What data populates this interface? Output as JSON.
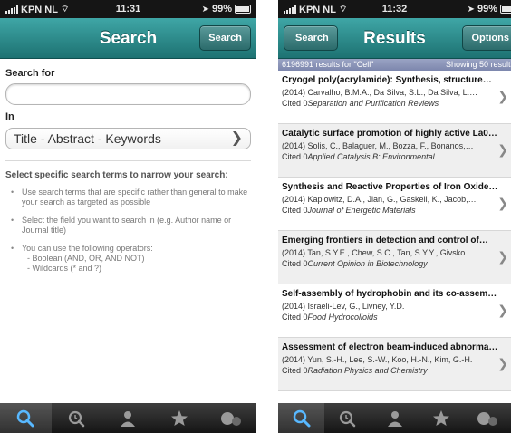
{
  "left": {
    "status": {
      "carrier": "KPN NL",
      "time": "11:31",
      "battery": "99%"
    },
    "nav": {
      "title": "Search",
      "search_button": "Search"
    },
    "form": {
      "search_for_label": "Search for",
      "search_value": "",
      "in_label": "In",
      "in_selected": "Title - Abstract - Keywords"
    },
    "help": {
      "title": "Select specific search terms to narrow your search:",
      "tip1": "Use search terms that are specific rather than general to make your search as targeted as possible",
      "tip2": "Select the field you want to search in (e.g. Author name or Journal title)",
      "tip3": "You can use the following operators:",
      "tip3_sub1": "- Boolean (AND, OR, AND NOT)",
      "tip3_sub2": "- Wildcards (* and ?)"
    },
    "tabs": [
      "search-icon",
      "recent-search-icon",
      "people-icon",
      "star-icon",
      "more-icon"
    ],
    "active_tab": 0
  },
  "right": {
    "status": {
      "carrier": "KPN NL",
      "time": "11:32",
      "battery": "99%"
    },
    "nav": {
      "title": "Results",
      "back_button": "Search",
      "options_button": "Options"
    },
    "results_bar": {
      "count": "6196991 results for \"Cell\"",
      "showing": "Showing 50 results"
    },
    "items": [
      {
        "title": "Cryogel poly(acrylamide): Synthesis, structure…",
        "authors": "(2014) Carvalho, B.M.A., Da Silva, S.L., Da Silva, L.…",
        "cited": "Cited 0",
        "journal": "Separation and Purification Reviews"
      },
      {
        "title": "Catalytic surface promotion of highly active La0…",
        "authors": "(2014) Solis, C., Balaguer, M., Bozza, F., Bonanos,…",
        "cited": "Cited 0",
        "journal": "Applied Catalysis B: Environmental"
      },
      {
        "title": "Synthesis and Reactive Properties of Iron Oxide-…",
        "authors": "(2014) Kaplowitz, D.A., Jian, G., Gaskell, K., Jacob,…",
        "cited": "Cited 0",
        "journal": "Journal of Energetic Materials"
      },
      {
        "title": "Emerging frontiers in detection and control of…",
        "authors": "(2014) Tan, S.Y.E., Chew, S.C., Tan, S.Y.Y., Givsko…",
        "cited": "Cited 0",
        "journal": "Current Opinion in Biotechnology"
      },
      {
        "title": "Self-assembly of hydrophobin and its co-assem…",
        "authors": "(2014) Israeli-Lev, G., Livney, Y.D.",
        "cited": "Cited 0",
        "journal": "Food Hydrocolloids"
      },
      {
        "title": "Assessment of electron beam-induced abnorma…",
        "authors": "(2014) Yun, S.-H., Lee, S.-W., Koo, H.-N., Kim, G.-H.",
        "cited": "Cited 0",
        "journal": "Radiation Physics and Chemistry"
      }
    ],
    "tabs": [
      "search-icon",
      "recent-search-icon",
      "people-icon",
      "star-icon",
      "more-icon"
    ],
    "active_tab": 0
  },
  "colors": {
    "nav_teal": "#2a8585",
    "results_bar": "#8b93b8",
    "tabbar": "#1e1e1e"
  }
}
